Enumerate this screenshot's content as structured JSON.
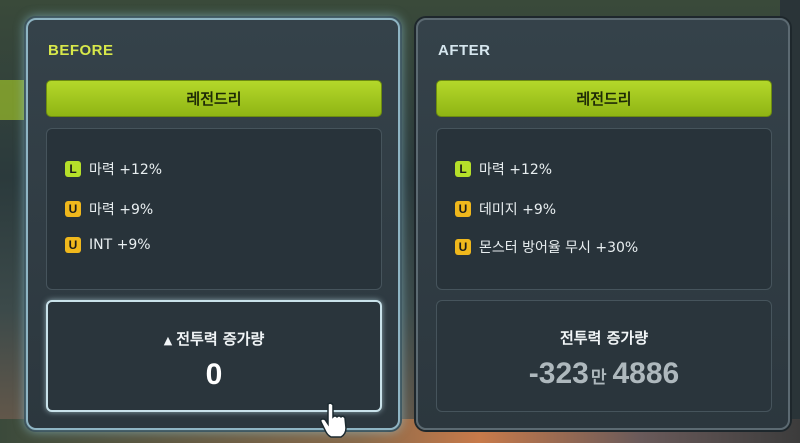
{
  "before": {
    "title": "BEFORE",
    "grade": "레전드리",
    "options": [
      {
        "tier": "L",
        "text": "마력 +12%"
      },
      {
        "tier": "U",
        "text": "마력 +9%"
      },
      {
        "tier": "U",
        "text": "INT +9%"
      }
    ],
    "stat_label": "전투력 증가량",
    "stat_value": "0"
  },
  "after": {
    "title": "AFTER",
    "grade": "레전드리",
    "options": [
      {
        "tier": "L",
        "text": "마력 +12%"
      },
      {
        "tier": "U",
        "text": "데미지 +9%"
      },
      {
        "tier": "U",
        "text": "몬스터 방어율 무시 +30%"
      }
    ],
    "stat_label": "전투력 증가량",
    "stat_value_main": "-323",
    "stat_value_unit": "만",
    "stat_value_rest": "4886"
  },
  "colors": {
    "grade_green": "#b4d82a",
    "badge_legendary": "#b6e02a",
    "badge_unique": "#f0b81c",
    "before_title": "#d8e84a"
  },
  "icons": {
    "increase": "triangle-up-icon",
    "cursor": "hand-pointer-icon"
  }
}
